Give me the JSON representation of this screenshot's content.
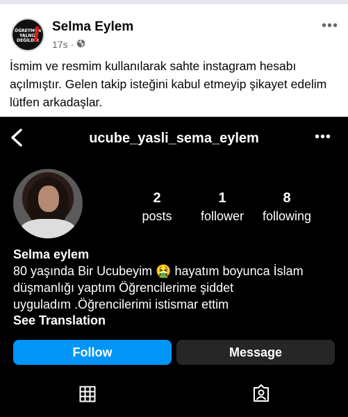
{
  "post": {
    "author": "Selma Eylem",
    "time": "17s",
    "separator": "·",
    "avatar_text": "ÖĞRETMEN YALNIZ DEĞİLDİR",
    "text": "İsmim ve resmim kullanılarak sahte instagram hesabı açılmıştır. Gelen takip isteğini kabul etmeyip şikayet edelim lütfen arkadaşlar."
  },
  "instagram": {
    "username": "ucube_yasli_sema_eylem",
    "stats": [
      {
        "value": "2",
        "label": "posts"
      },
      {
        "value": "1",
        "label": "follower"
      },
      {
        "value": "8",
        "label": "following"
      }
    ],
    "bio_name": "Selma eylem",
    "bio_lines": [
      "80 yaşında Bir Ucubeyim 🤮 hayatım boyunca İslam",
      "düşmanlığı yaptım Öğrencilerime şiddet",
      "uyguladım .Öğrencilerimi istismar ettim"
    ],
    "see_translation": "See Translation",
    "follow_label": "Follow",
    "message_label": "Message"
  },
  "icons": {
    "back": "chevron-left-icon",
    "more": "more-horizontal-icon",
    "globe": "globe-icon",
    "grid": "grid-icon",
    "tagged": "tagged-person-icon"
  },
  "colors": {
    "follow_button": "#0095f6",
    "message_button": "#262626",
    "instagram_bg": "#000000",
    "meta_text": "#65676b"
  }
}
